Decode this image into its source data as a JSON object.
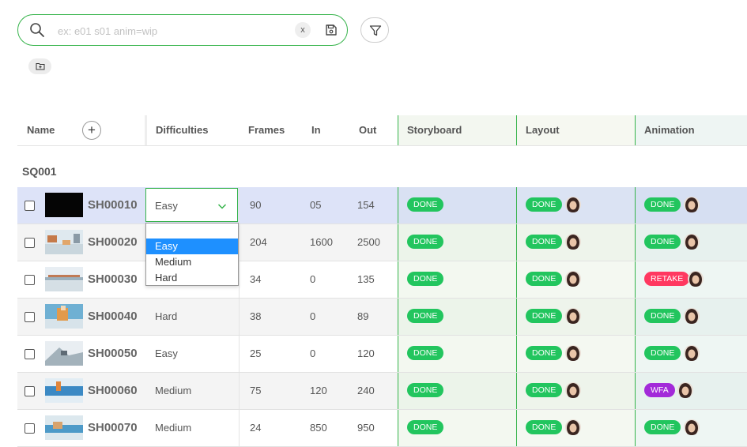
{
  "search": {
    "placeholder": "ex: e01 s01 anim=wip",
    "value": "",
    "clear_label": "x"
  },
  "toolbar": {
    "filter_icon": "filter-icon",
    "save_icon": "save-icon",
    "folder_icon": "folder-add-icon"
  },
  "columns": {
    "name": "Name",
    "add_label": "+",
    "difficulties": "Difficulties",
    "frames": "Frames",
    "in": "In",
    "out": "Out",
    "storyboard": "Storyboard",
    "layout": "Layout",
    "animation": "Animation"
  },
  "sequence": "SQ001",
  "colors": {
    "accent": "#35b34a",
    "done": "#22c55e",
    "retake": "#ff3860",
    "wfa": "#a32ad9",
    "selected_row": "#dde3f8",
    "dropdown_selected": "#1e90ff"
  },
  "shots": [
    {
      "name": "SH00010",
      "difficulty": "Easy",
      "frames": "90",
      "in": "05",
      "out": "154",
      "storyboard": "DONE",
      "layout": "DONE",
      "animation": "DONE",
      "animation_status": "done",
      "selected": true
    },
    {
      "name": "SH00020",
      "difficulty": "",
      "frames": "204",
      "in": "1600",
      "out": "2500",
      "storyboard": "DONE",
      "layout": "DONE",
      "animation": "DONE",
      "animation_status": "done"
    },
    {
      "name": "SH00030",
      "difficulty": "",
      "frames": "34",
      "in": "0",
      "out": "135",
      "storyboard": "DONE",
      "layout": "DONE",
      "animation": "RETAKE",
      "animation_status": "retake"
    },
    {
      "name": "SH00040",
      "difficulty": "Hard",
      "frames": "38",
      "in": "0",
      "out": "89",
      "storyboard": "DONE",
      "layout": "DONE",
      "animation": "DONE",
      "animation_status": "done"
    },
    {
      "name": "SH00050",
      "difficulty": "Easy",
      "frames": "25",
      "in": "0",
      "out": "120",
      "storyboard": "DONE",
      "layout": "DONE",
      "animation": "DONE",
      "animation_status": "done"
    },
    {
      "name": "SH00060",
      "difficulty": "Medium",
      "frames": "75",
      "in": "120",
      "out": "240",
      "storyboard": "DONE",
      "layout": "DONE",
      "animation": "WFA",
      "animation_status": "wfa"
    },
    {
      "name": "SH00070",
      "difficulty": "Medium",
      "frames": "24",
      "in": "850",
      "out": "950",
      "storyboard": "DONE",
      "layout": "DONE",
      "animation": "DONE",
      "animation_status": "done"
    }
  ],
  "difficulty_select": {
    "value": "Easy",
    "options": [
      "Easy",
      "Medium",
      "Hard"
    ],
    "highlighted": "Easy"
  }
}
